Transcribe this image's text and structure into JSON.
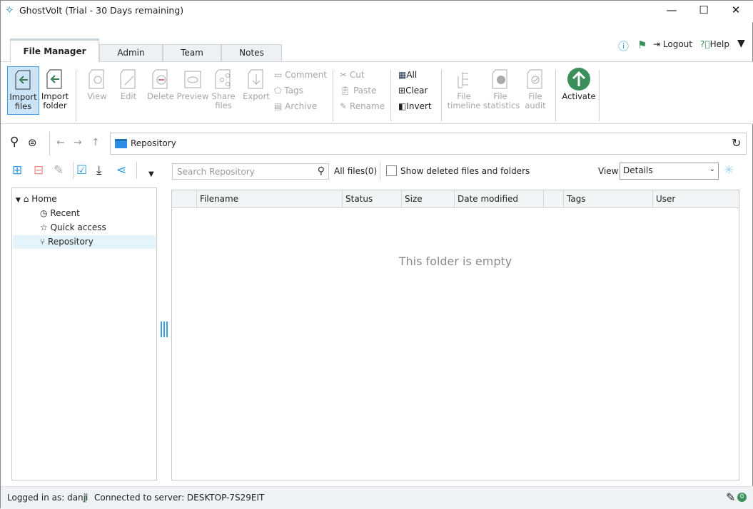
{
  "window": {
    "title": "GhostVolt (Trial - 30 Days remaining)",
    "minimize": "—",
    "maximize": "☐",
    "close": "✕"
  },
  "tabs": [
    {
      "label": "File Manager",
      "active": true
    },
    {
      "label": "Admin"
    },
    {
      "label": "Team"
    },
    {
      "label": "Notes"
    }
  ],
  "header_actions": {
    "logout": "Logout",
    "help": "Help"
  },
  "ribbon": {
    "import_files": "Import files",
    "import_folder": "Import folder",
    "view": "View",
    "edit": "Edit",
    "delete": "Delete",
    "preview": "Preview",
    "share_files": "Share files",
    "export": "Export",
    "comment": "Comment",
    "tags": "Tags",
    "archive": "Archive",
    "cut": "Cut",
    "paste": "Paste",
    "rename": "Rename",
    "all": "All",
    "clear": "Clear",
    "invert": "Invert",
    "file_timeline": "File timeline",
    "file_statistics": "File statistics",
    "file_audit": "File audit",
    "activate": "Activate"
  },
  "colors": {
    "accent": "#3b9fe3",
    "activate": "#3a8f5a",
    "import_arrow": "#3a7d56"
  },
  "address": {
    "path": "Repository"
  },
  "search": {
    "placeholder": "Search Repository"
  },
  "file_count": "All files(0)",
  "show_deleted": {
    "label": "Show deleted files and folders",
    "checked": false
  },
  "view": {
    "label": "View",
    "selected": "Details"
  },
  "tree": [
    {
      "label": "Home",
      "icon": "home-icon"
    },
    {
      "label": "Recent",
      "icon": "clock-icon"
    },
    {
      "label": "Quick access",
      "icon": "star-icon"
    },
    {
      "label": "Repository",
      "icon": "branch-icon",
      "selected": true
    }
  ],
  "columns": [
    "Filename",
    "Status",
    "Size",
    "Date modified",
    "",
    "Tags",
    "User"
  ],
  "empty_message": "This folder is empty",
  "status": {
    "logged_in": "Logged in as: danji",
    "separator": "|",
    "connected": "Connected to server:  DESKTOP-7S29EIT",
    "badge": "0"
  }
}
